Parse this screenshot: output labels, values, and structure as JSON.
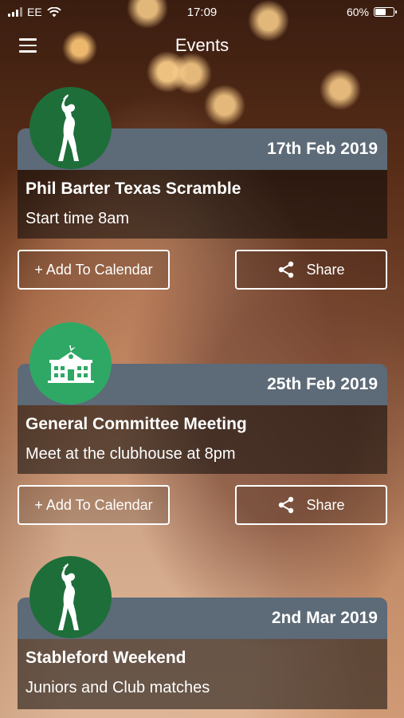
{
  "status_bar": {
    "carrier": "EE",
    "time": "17:09",
    "battery": "60%",
    "battery_level": 0.6
  },
  "nav": {
    "title": "Events",
    "menu_icon": "hamburger-menu-icon"
  },
  "events": [
    {
      "date": "17th Feb 2019",
      "title": "Phil Barter Texas Scramble",
      "subtitle": "Start time 8am",
      "icon": "golfer-icon",
      "icon_color": "#1e6e3a",
      "add_to_calendar": "+ Add To Calendar",
      "share": "Share"
    },
    {
      "date": "25th Feb 2019",
      "title": "General Committee Meeting",
      "subtitle": "Meet at the clubhouse at 8pm",
      "icon": "clubhouse-icon",
      "icon_color": "#2fa866",
      "add_to_calendar": "+ Add To Calendar",
      "share": "Share"
    },
    {
      "date": "2nd Mar 2019",
      "title": "Stableford Weekend",
      "subtitle": "Juniors and Club matches",
      "icon": "golfer-icon",
      "icon_color": "#1e6e3a"
    }
  ],
  "colors": {
    "card_header": "#5d6a77",
    "golf_green": "#1e6e3a",
    "meeting_green": "#2fa866"
  }
}
